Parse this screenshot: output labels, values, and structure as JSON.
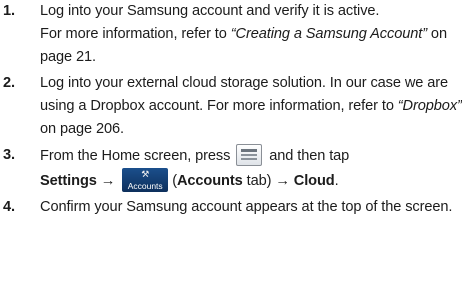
{
  "steps": [
    {
      "number": "1.",
      "text_a": "Log into your Samsung account and verify it is active.",
      "text_b": "For more information, refer to ",
      "ref": "“Creating a Samsung Account”",
      "text_c": " on page 21."
    },
    {
      "number": "2.",
      "text_a": "Log into your external cloud storage solution. In our case we are using a Dropbox account. For more information, refer to ",
      "ref": "“Dropbox”",
      "text_b": " on page 206."
    },
    {
      "number": "3.",
      "text_a": "From the Home screen, press ",
      "text_b": " and then tap",
      "settings": "Settings",
      "arrow1": " → ",
      "paren_open": "(",
      "accounts_tab": "Accounts",
      "tab_word": " tab) ",
      "arrow2": "→ ",
      "cloud": "Cloud",
      "period": "."
    },
    {
      "number": "4.",
      "text_a": "Confirm your Samsung account appears at the top of the screen."
    }
  ],
  "icons": {
    "menu_key": "menu-key-icon",
    "accounts": "accounts-tab-icon",
    "accounts_label": "Accounts",
    "accounts_color": "#1b4f8c"
  }
}
